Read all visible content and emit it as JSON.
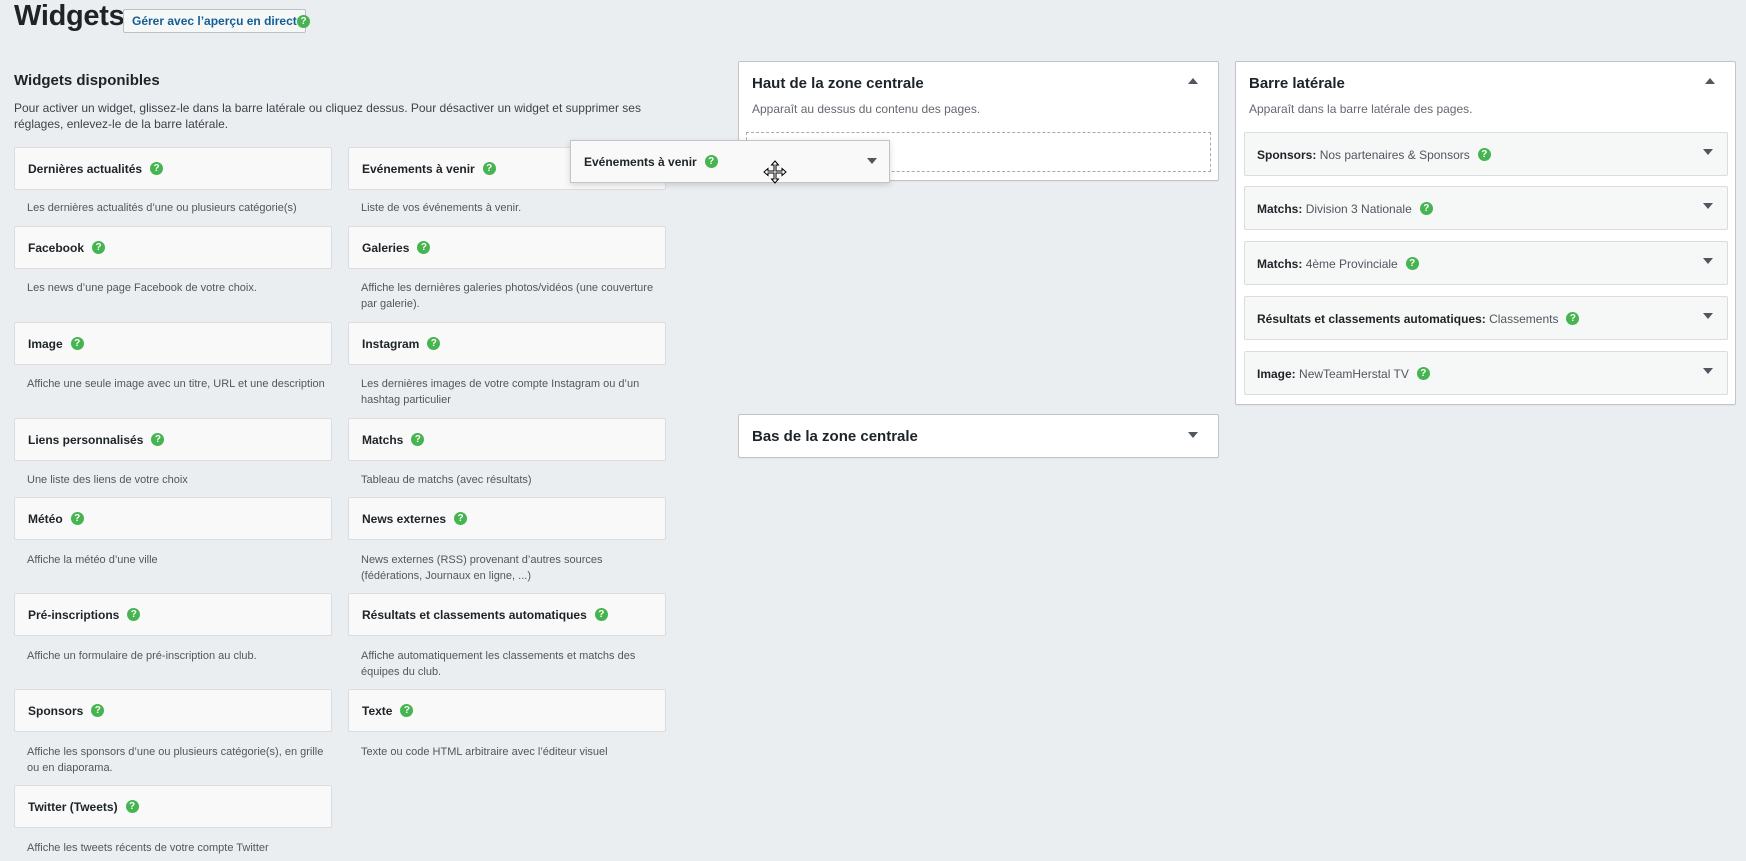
{
  "header": {
    "title": "Widgets",
    "live_button": "Gérer avec l’aperçu en direct",
    "help_icon": "?"
  },
  "available": {
    "title": "Widgets disponibles",
    "description": "Pour activer un widget, glissez-le dans la barre latérale ou cliquez dessus. Pour désactiver un widget et supprimer ses réglages, enlevez-le de la barre latérale.",
    "left": [
      {
        "label": "Dernières actualités",
        "desc": "Les dernières actualités d’une ou plusieurs catégorie(s)"
      },
      {
        "label": "Facebook",
        "desc": "Les news d’une page Facebook de votre choix."
      },
      {
        "label": "Image",
        "desc": "Affiche une seule image avec un titre, URL et une description"
      },
      {
        "label": "Liens personnalisés",
        "desc": "Une liste des liens de votre choix"
      },
      {
        "label": "Météo",
        "desc": "Affiche la météo d’une ville"
      },
      {
        "label": "Pré-inscriptions",
        "desc": "Affiche un formulaire de pré-inscription au club."
      },
      {
        "label": "Sponsors",
        "desc": "Affiche les sponsors d’une ou plusieurs catégorie(s), en grille ou en diaporama."
      },
      {
        "label": "Twitter (Tweets)",
        "desc": "Affiche les tweets récents de votre compte Twitter"
      }
    ],
    "right": [
      {
        "label": "Evénements à venir",
        "desc": "Liste de vos événements à venir."
      },
      {
        "label": "Galeries",
        "desc": "Affiche les dernières galeries photos/vidéos (une couverture par galerie)."
      },
      {
        "label": "Instagram",
        "desc": "Les dernières images de votre compte Instagram ou d’un hashtag particulier"
      },
      {
        "label": "Matchs",
        "desc": "Tableau de matchs (avec résultats)"
      },
      {
        "label": "News externes",
        "desc": "News externes (RSS) provenant d’autres sources (fédérations, Journaux en ligne, ...)"
      },
      {
        "label": "Résultats et classements automatiques",
        "desc": "Affiche automatiquement les classements et matchs des équipes du club."
      },
      {
        "label": "Texte",
        "desc": "Texte ou code HTML arbitraire avec l’éditeur visuel"
      }
    ]
  },
  "dragging_widget": {
    "label": "Evénements à venir"
  },
  "zones": {
    "top_center": {
      "title": "Haut de la zone centrale",
      "subtitle": "Apparaît au dessus du contenu des pages."
    },
    "bottom_center": {
      "title": "Bas de la zone centrale"
    },
    "sidebar": {
      "title": "Barre latérale",
      "subtitle": "Apparaît dans la barre latérale des pages.",
      "items": [
        {
          "type": "Sponsors:",
          "name": "Nos partenaires & Sponsors"
        },
        {
          "type": "Matchs:",
          "name": "Division 3 Nationale"
        },
        {
          "type": "Matchs:",
          "name": "4ème Provinciale"
        },
        {
          "type": "Résultats et classements automatiques:",
          "name": "Classements"
        },
        {
          "type": "Image:",
          "name": "NewTeamHerstal TV"
        }
      ]
    }
  },
  "colors": {
    "help_green": "#46b450",
    "link_blue": "#135e96"
  }
}
